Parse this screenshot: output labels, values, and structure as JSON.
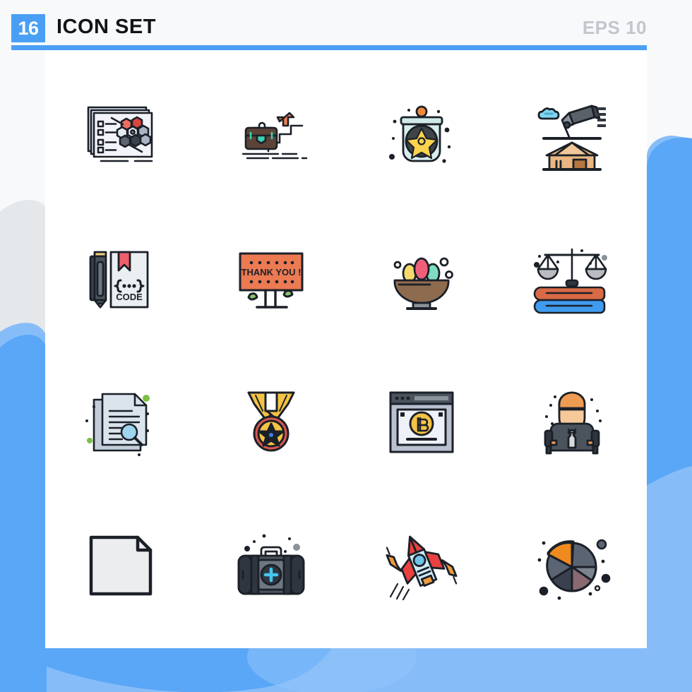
{
  "header": {
    "count_badge": "16",
    "title": "ICON SET",
    "format_label": "EPS 10",
    "accent_color": "#4a9ff5",
    "badge_text_color": "#ffffff",
    "title_color": "#111418",
    "format_color": "#c2c7cd"
  },
  "page": {
    "background_color": "#f7f9fb",
    "card_color": "#ffffff",
    "blob_blue": "#5aa7f7",
    "blob_blue_light": "#86bdf9",
    "blob_grey": "#e4e8ea"
  },
  "grid": {
    "columns": 4,
    "rows": 4,
    "total": 16
  },
  "icons": [
    {
      "index": 1,
      "row": 1,
      "col": 1,
      "name": "molecule-presentation-slides-icon",
      "label": "Molecule Presentation Slides",
      "colors": [
        "#eef1f8",
        "#e8553f",
        "#5e6472",
        "#b9c0cf"
      ]
    },
    {
      "index": 2,
      "row": 1,
      "col": 2,
      "name": "career-growth-briefcase-icon",
      "label": "Career Growth Briefcase",
      "colors": [
        "#5c4438",
        "#ef7d52",
        "#3ecfb0",
        "#2e2e2e"
      ]
    },
    {
      "index": 3,
      "row": 1,
      "col": 3,
      "name": "biohazard-jar-icon",
      "label": "Biohazard Jar",
      "colors": [
        "#cfeae8",
        "#fcd34d",
        "#3f4449",
        "#ef8a3c"
      ]
    },
    {
      "index": 4,
      "row": 1,
      "col": 4,
      "name": "projector-house-icon",
      "label": "Projector Over House",
      "colors": [
        "#5a6169",
        "#eab681",
        "#7fd6f2",
        "#b5773f"
      ]
    },
    {
      "index": 5,
      "row": 2,
      "col": 1,
      "name": "code-book-pen-icon",
      "label": "Code Book With Pen",
      "colors": [
        "#eceff1",
        "#ef5f6b",
        "#4b535c",
        "#f0cf7a"
      ],
      "text": "CODE"
    },
    {
      "index": 6,
      "row": 2,
      "col": 2,
      "name": "thank-you-billboard-icon",
      "label": "Thank You Billboard",
      "colors": [
        "#ec7a53",
        "#8dc26f",
        "#1a1a1a"
      ],
      "text": "THANK YOU !"
    },
    {
      "index": 7,
      "row": 2,
      "col": 3,
      "name": "easter-eggs-bowl-icon",
      "label": "Easter Eggs Bowl",
      "colors": [
        "#8e6b4e",
        "#ef5f7a",
        "#f5d96b",
        "#7fdcc0"
      ]
    },
    {
      "index": 8,
      "row": 2,
      "col": 4,
      "name": "law-scales-books-icon",
      "label": "Law Scales On Books",
      "colors": [
        "#d96a45",
        "#3f9bef",
        "#b9bdc2",
        "#1a1a1a"
      ]
    },
    {
      "index": 9,
      "row": 3,
      "col": 1,
      "name": "document-search-icon",
      "label": "Document Search",
      "colors": [
        "#c3cdda",
        "#e6ecf3",
        "#7bc043",
        "#9fd3ee"
      ]
    },
    {
      "index": 10,
      "row": 3,
      "col": 2,
      "name": "award-medal-icon",
      "label": "Award Medal",
      "colors": [
        "#f5c344",
        "#d9564f",
        "#1a1a1a",
        "#3f7fd9"
      ]
    },
    {
      "index": 11,
      "row": 3,
      "col": 3,
      "name": "bitcoin-browser-window-icon",
      "label": "Bitcoin Browser Window",
      "colors": [
        "#b9c0cf",
        "#f5c344",
        "#4b535c",
        "#eef1f8"
      ]
    },
    {
      "index": 12,
      "row": 3,
      "col": 4,
      "name": "mechanic-worker-icon",
      "label": "Mechanic Worker",
      "colors": [
        "#f5c99a",
        "#ef9b52",
        "#4b535c",
        "#d9d9d9"
      ]
    },
    {
      "index": 13,
      "row": 4,
      "col": 1,
      "name": "blank-file-icon",
      "label": "Blank File",
      "colors": [
        "#ecedef",
        "#1a1a1a"
      ]
    },
    {
      "index": 14,
      "row": 4,
      "col": 2,
      "name": "first-aid-kit-icon",
      "label": "First Aid Kit",
      "colors": [
        "#4b535c",
        "#2f3640",
        "#45c6f0",
        "#8a929c"
      ]
    },
    {
      "index": 15,
      "row": 4,
      "col": 3,
      "name": "rocket-launch-icon",
      "label": "Rocket Launch",
      "colors": [
        "#e8413f",
        "#ef9b3c",
        "#cfeaf7",
        "#6fc4e8"
      ]
    },
    {
      "index": 16,
      "row": 4,
      "col": 4,
      "name": "pie-chart-icon",
      "label": "Pie Chart",
      "colors": [
        "#ef8a1e",
        "#5a6472",
        "#3a4050",
        "#8a6a70"
      ]
    }
  ]
}
